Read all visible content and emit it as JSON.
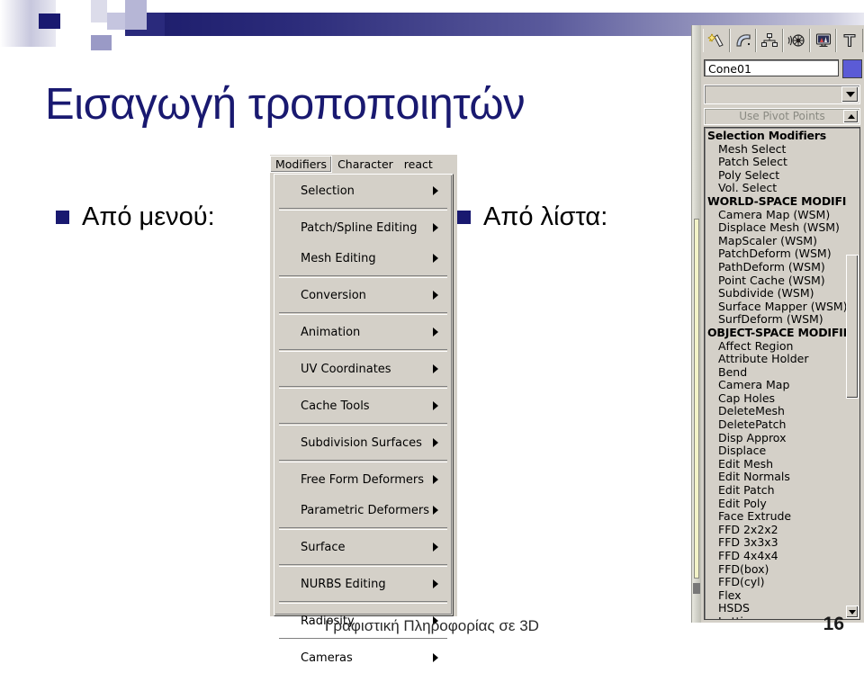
{
  "slide": {
    "title": "Εισαγωγή τροποποιητών",
    "bullets": [
      {
        "label": "Από μενού:"
      },
      {
        "label": "Από λίστα:"
      }
    ],
    "footer": "Γραφιστική Πληροφορίας σε 3D",
    "page_number": "16",
    "accent_color": "#191970"
  },
  "max_menu": {
    "menubar": [
      {
        "label": "Modifiers",
        "active": true
      },
      {
        "label": "Character",
        "active": false
      },
      {
        "label": "react",
        "active": false
      }
    ],
    "items": [
      {
        "label": "Selection",
        "submenu": true,
        "sep_after": true
      },
      {
        "label": "Patch/Spline Editing",
        "submenu": true,
        "sep_after": false
      },
      {
        "label": "Mesh Editing",
        "submenu": true,
        "sep_after": true
      },
      {
        "label": "Conversion",
        "submenu": true,
        "sep_after": true
      },
      {
        "label": "Animation",
        "submenu": true,
        "sep_after": true
      },
      {
        "label": "UV Coordinates",
        "submenu": true,
        "sep_after": true
      },
      {
        "label": "Cache Tools",
        "submenu": true,
        "sep_after": true
      },
      {
        "label": "Subdivision Surfaces",
        "submenu": true,
        "sep_after": true
      },
      {
        "label": "Free Form Deformers",
        "submenu": true,
        "sep_after": false
      },
      {
        "label": "Parametric Deformers",
        "submenu": true,
        "sep_after": true
      },
      {
        "label": "Surface",
        "submenu": true,
        "sep_after": true
      },
      {
        "label": "NURBS Editing",
        "submenu": true,
        "sep_after": true
      },
      {
        "label": "Radiosity",
        "submenu": true,
        "sep_after": true
      },
      {
        "label": "Cameras",
        "submenu": true,
        "sep_after": false
      }
    ]
  },
  "max_panel": {
    "tabs": [
      {
        "name": "create-tab",
        "icon": "arrow-star-icon"
      },
      {
        "name": "modify-tab",
        "icon": "bent-tube-icon"
      },
      {
        "name": "hierarchy-tab",
        "icon": "hierarchy-icon"
      },
      {
        "name": "motion-tab",
        "icon": "wheel-icon"
      },
      {
        "name": "display-tab",
        "icon": "monitor-icon"
      },
      {
        "name": "utilities-tab",
        "icon": "hammer-icon"
      }
    ],
    "object_name": "Cone01",
    "object_color": "#5b5bd6",
    "modifier_combo_value": "",
    "pivot_label": "Use Pivot Points",
    "modifier_groups": [
      {
        "group": "Selection Modifiers",
        "items": [
          "Mesh Select",
          "Patch Select",
          "Poly Select",
          "Vol. Select"
        ]
      },
      {
        "group": "WORLD-SPACE MODIFIE",
        "items": [
          "Camera Map (WSM)",
          "Displace Mesh (WSM)",
          "MapScaler (WSM)",
          "PatchDeform (WSM)",
          "PathDeform (WSM)",
          "Point Cache (WSM)",
          "Subdivide (WSM)",
          "Surface Mapper (WSM)",
          "SurfDeform (WSM)"
        ]
      },
      {
        "group": "OBJECT-SPACE MODIFIE",
        "items": [
          "Affect Region",
          "Attribute Holder",
          "Bend",
          "Camera Map",
          "Cap Holes",
          "DeleteMesh",
          "DeletePatch",
          "Disp Approx",
          "Displace",
          "Edit Mesh",
          "Edit Normals",
          "Edit Patch",
          "Edit Poly",
          "Face Extrude",
          "FFD 2x2x2",
          "FFD 3x3x3",
          "FFD 4x4x4",
          "FFD(box)",
          "FFD(cyl)",
          "Flex",
          "HSDS",
          "Lattice"
        ]
      }
    ]
  }
}
